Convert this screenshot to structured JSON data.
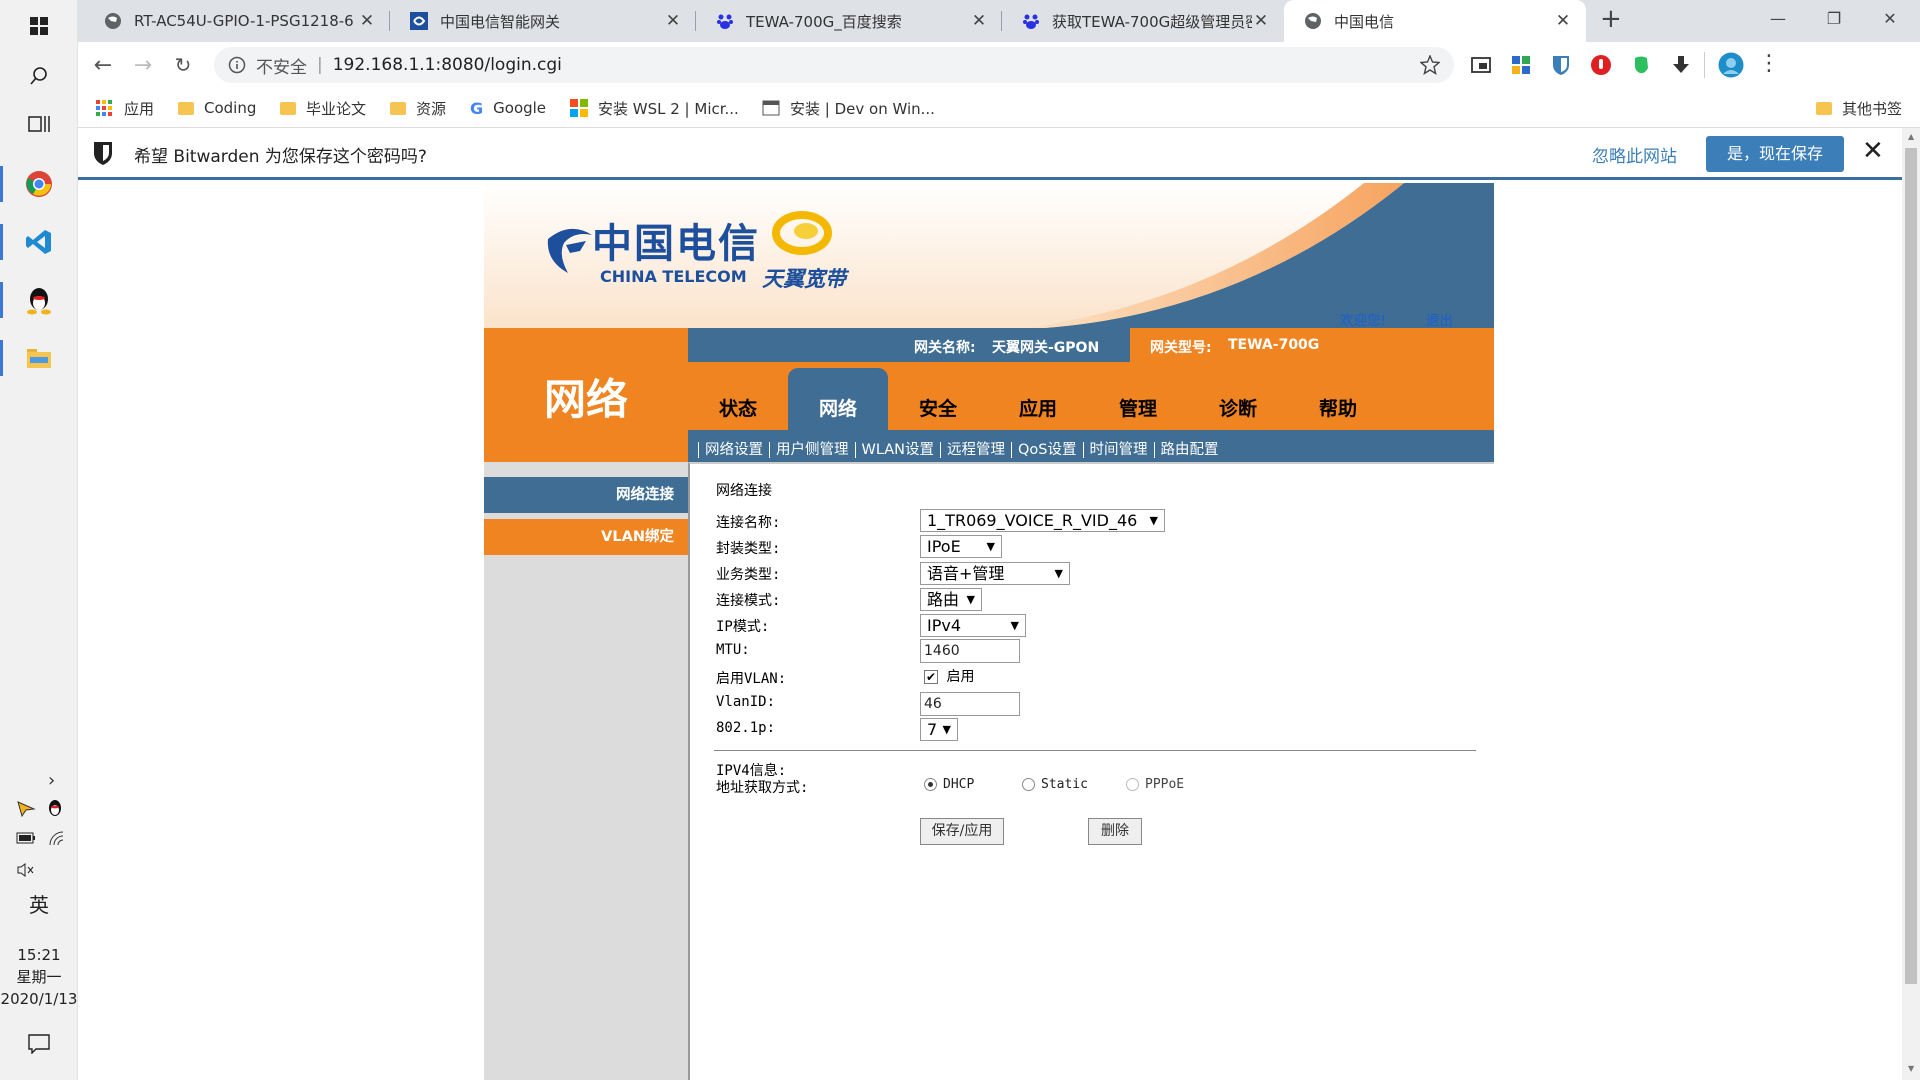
{
  "taskbar": {
    "clock_time": "15:21",
    "clock_day": "星期一",
    "clock_date": "2020/1/13",
    "ime": "英"
  },
  "tabs": [
    {
      "title": "RT-AC54U-GPIO-1-PSG1218-6",
      "icon": "globe-icon"
    },
    {
      "title": "中国电信智能网关",
      "icon": "telecom-icon"
    },
    {
      "title": "TEWA-700G_百度搜索",
      "icon": "baidu-icon"
    },
    {
      "title": "获取TEWA-700G超级管理员密码",
      "icon": "baidu-icon"
    },
    {
      "title": "中国电信",
      "icon": "globe-icon",
      "active": true
    }
  ],
  "toolbar": {
    "security_label": "不安全",
    "url": "192.168.1.1:8080/login.cgi"
  },
  "bookmarks": [
    {
      "label": "应用",
      "icon": "apps-grid-icon"
    },
    {
      "label": "Coding",
      "icon": "folder-icon"
    },
    {
      "label": "毕业论文",
      "icon": "folder-icon"
    },
    {
      "label": "资源",
      "icon": "folder-icon"
    },
    {
      "label": "Google",
      "icon": "google-icon"
    },
    {
      "label": "安装 WSL 2 | Micr...",
      "icon": "microsoft-icon"
    },
    {
      "label": "安装 | Dev on Win...",
      "icon": "page-icon"
    },
    {
      "label": "其他书签",
      "icon": "folder-icon"
    }
  ],
  "bitwarden": {
    "message": "希望 Bitwarden 为您保存这个密码吗?",
    "ignore_label": "忽略此网站",
    "save_label": "是，现在保存"
  },
  "router": {
    "logo_cn": "中国电信",
    "logo_en": "CHINA TELECOM",
    "brand2": "天翼宽带",
    "welcome": "欢迎您!",
    "logout": "退出",
    "gateway_name_label": "网关名称:",
    "gateway_name": "天翼网关-GPON",
    "gateway_model_label": "网关型号:",
    "gateway_model": "TEWA-700G",
    "section_title": "网络",
    "main_tabs": [
      "状态",
      "网络",
      "安全",
      "应用",
      "管理",
      "诊断",
      "帮助"
    ],
    "active_tab": "网络",
    "sub_tabs": [
      "网络设置",
      "用户侧管理",
      "WLAN设置",
      "远程管理",
      "QoS设置",
      "时间管理",
      "路由配置"
    ],
    "left_menu": [
      "网络连接",
      "VLAN绑定"
    ],
    "content_title": "网络连接",
    "form": {
      "conn_name_label": "连接名称:",
      "conn_name_value": "1_TR069_VOICE_R_VID_46",
      "encap_label": "封装类型:",
      "encap_value": "IPoE",
      "service_label": "业务类型:",
      "service_value": "语音+管理",
      "mode_label": "连接模式:",
      "mode_value": "路由",
      "ipmode_label": "IP模式:",
      "ipmode_value": "IPv4",
      "mtu_label": "MTU:",
      "mtu_value": "1460",
      "vlan_enable_label": "启用VLAN:",
      "vlan_enable_text": "启用",
      "vlan_enabled": true,
      "vlanid_label": "VlanID:",
      "vlanid_value": "46",
      "dot1p_label": "802.1p:",
      "dot1p_value": "7",
      "ipv4_info_label": "IPV4信息:",
      "addr_mode_label": "地址获取方式:",
      "addr_options": [
        "DHCP",
        "Static",
        "PPPoE"
      ],
      "addr_selected": "DHCP",
      "save_button": "保存/应用",
      "delete_button": "删除"
    }
  },
  "colors": {
    "orange": "#ef8421",
    "steel_blue": "#3f6d93",
    "bitwarden_blue": "#3c7fb8",
    "link_blue": "#1a5fd1"
  }
}
